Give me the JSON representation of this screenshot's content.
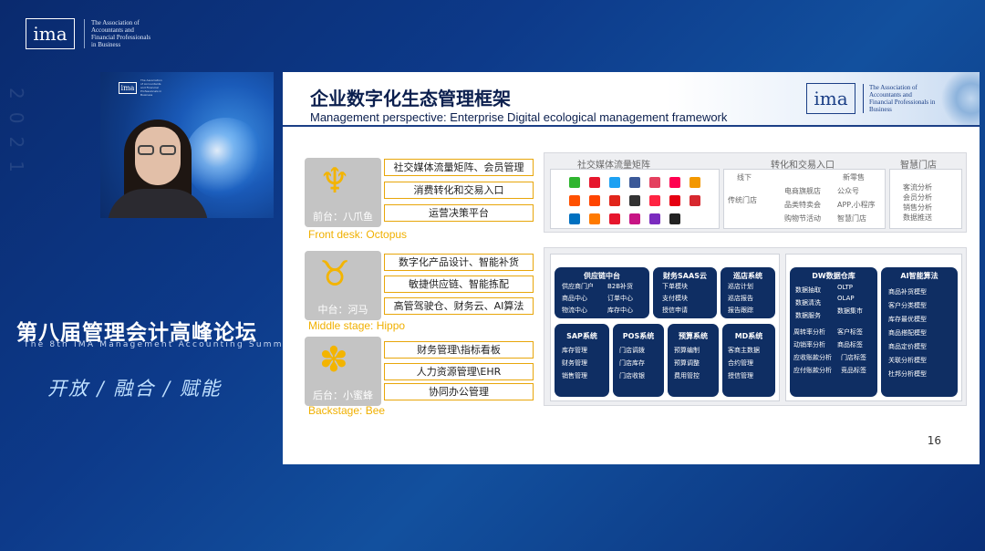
{
  "topbar": {
    "logo": "ima",
    "assoc": "The Association of\nAccountants and\nFinancial Professionals\nin Business"
  },
  "watermark": "2021",
  "video": {
    "logo": "ima",
    "assoc": "The Association of Accountants and Financial Professionals in Business"
  },
  "summit": {
    "title": "第八届管理会计高峰论坛",
    "subtitle": "The 8th IMA Management Accounting Summit",
    "slogan": "开放 / 融合 / 赋能"
  },
  "slide": {
    "title": "企业数字化生态管理框架",
    "subtitle": "Management perspective: Enterprise Digital ecological management framework",
    "logo": "ima",
    "logo_text": "The Association of Accountants and Financial Professionals in Business",
    "page_number": "16",
    "tiers": [
      {
        "label": "前台：八爪鱼",
        "en": "Front desk: Octopus",
        "glyph": "♆",
        "items": [
          "社交媒体流量矩阵、会员管理",
          "消费转化和交易入口",
          "运营决策平台"
        ]
      },
      {
        "label": "中台：河马",
        "en": "Middle stage: Hippo",
        "glyph": "♉",
        "items": [
          "数字化产品设计、智能补货",
          "敏捷供应链、智能拣配",
          "高管驾驶仓、财务云、AI算法"
        ]
      },
      {
        "label": "后台：小蜜蜂",
        "en": "Backstage: Bee",
        "glyph": "✽",
        "items": [
          "财务管理\\指标看板",
          "人力资源管理\\EHR",
          "协同办公管理"
        ]
      }
    ],
    "front_panel": {
      "social": {
        "title": "社交媒体流量矩阵"
      },
      "conversion": {
        "title": "转化和交易入口",
        "offline": {
          "title": "线下",
          "items": [
            "传统门店"
          ]
        },
        "mid": {
          "items": [
            "电商旗舰店",
            "品类特卖会",
            "购物节活动"
          ]
        },
        "new_biz": {
          "title": "新零售",
          "items": [
            "公众号",
            "APP,小程序",
            "智慧门店"
          ]
        }
      },
      "smart_store": {
        "title": "智慧门店",
        "items": [
          "客流分析",
          "会员分析",
          "销售分析",
          "数据推送"
        ]
      }
    },
    "mid_boxes": [
      {
        "title": "供应链中台",
        "items": [
          "供应商门户",
          "B2B补货",
          "商品中心",
          "订单中心",
          "物流中心",
          "库存中心"
        ]
      },
      {
        "title": "财务SAAS云",
        "items": [
          "下单模块",
          "支付模块",
          "授信申请"
        ]
      },
      {
        "title": "巡店系统",
        "items": [
          "巡店计划",
          "巡店报告",
          "报告跟踪"
        ]
      },
      {
        "title": "SAP系统",
        "items": [
          "库存管理",
          "财务管理",
          "销售管理"
        ]
      },
      {
        "title": "POS系统",
        "items": [
          "门店调拨",
          "门店库存",
          "门店收银"
        ]
      },
      {
        "title": "预算系统",
        "items": [
          "预算编制",
          "预算调整",
          "费用管控"
        ]
      },
      {
        "title": "MD系统",
        "items": [
          "客商主数据",
          "合约管理",
          "授信管理"
        ]
      }
    ],
    "dw": {
      "title": "DW数据仓库",
      "items": [
        "数据抽取",
        "OLTP",
        "数据清洗",
        "OLAP",
        "数据服务",
        "数据集市",
        "周转率分析",
        "客户标签",
        "动销率分析",
        "商品标签",
        "应收账款分析",
        "门店标签",
        "应付账款分析",
        "竞品标签"
      ]
    },
    "ai": {
      "title": "AI智能算法",
      "items": [
        "商品补货模型",
        "客户分类模型",
        "库存最优模型",
        "商品搭配模型",
        "商品定价模型",
        "关联分析模型",
        "杜邦分析模型"
      ]
    }
  },
  "colors": {
    "accent": "#f0b000",
    "dark_box": "#0f2e63",
    "bg": "#0d3a8a"
  }
}
